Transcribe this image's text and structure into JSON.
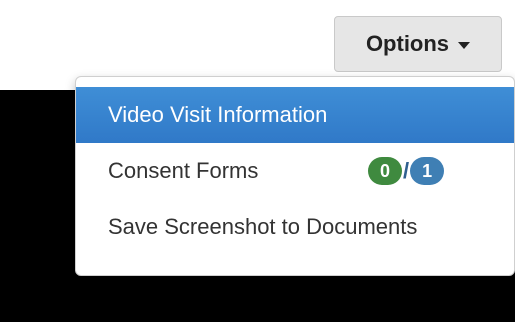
{
  "options_button": {
    "label": "Options",
    "caret_icon": "caret-down-icon"
  },
  "menu": {
    "items": [
      {
        "label": "Video Visit Information",
        "active": true
      },
      {
        "label": "Consent Forms",
        "badge_left": "0",
        "separator": "/",
        "badge_right": "1",
        "badge_left_color": "#3f8a3f",
        "badge_right_color": "#3f7fb4"
      },
      {
        "label": "Save Screenshot to Documents"
      }
    ]
  },
  "colors": {
    "accent": "#3079c8",
    "background_overlay": "#000000"
  }
}
